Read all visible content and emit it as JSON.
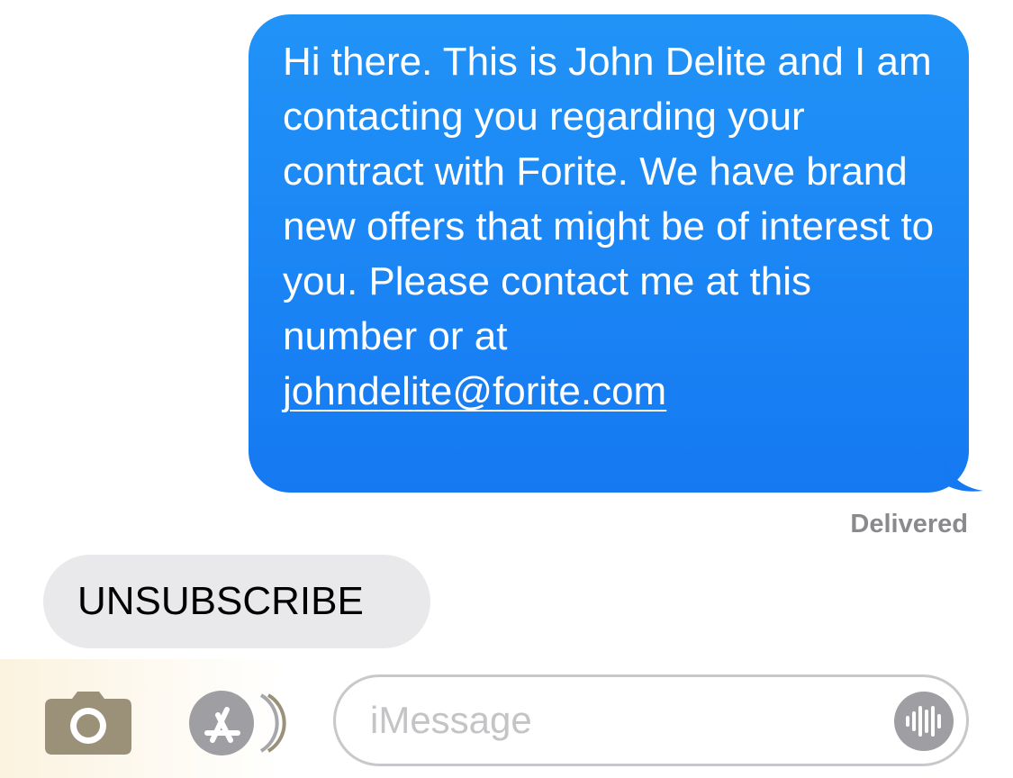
{
  "conversation": {
    "outgoing": {
      "text": "Hi there. This is John Delite and I am contacting you regarding your contract with Forite. We have brand new offers that might be of interest to you. Please contact me at this number or at",
      "link": "johndelite@forite.com",
      "status": "Delivered"
    },
    "incoming": {
      "text": "UNSUBSCRIBE"
    }
  },
  "composer": {
    "placeholder": "iMessage",
    "camera_icon": "camera-icon",
    "appstore_icon": "app-store-icon",
    "audio_icon": "audio-waveform-icon"
  },
  "colors": {
    "outgoing_bubble": "#1a86f5",
    "incoming_bubble": "#e9e9eb",
    "status_text": "#8a8a8e",
    "icon_fill": "#9b9078",
    "placeholder": "#c4c4c7"
  }
}
